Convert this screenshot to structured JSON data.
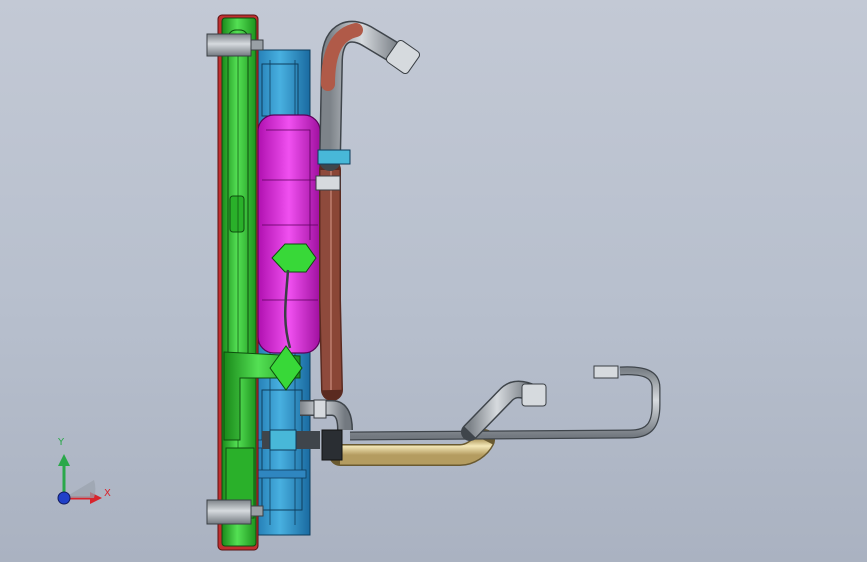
{
  "viewport": {
    "background": "#b9c0cd"
  },
  "triad": {
    "x_label": "X",
    "y_label": "Y",
    "x_color": "#d8242c",
    "y_color": "#2aa84a",
    "z_color": "#2040c8"
  },
  "components": {
    "radiator_color": "#2fc22f",
    "shroud_color": "#2a90c8",
    "expansion_tank_color": "#e020e0",
    "upper_hose_color": "#c07a6a",
    "steel_pipe_color": "#a0a6ac",
    "lower_pipe_color": "#e8d8a0",
    "clamp_color": "#48b8d8"
  }
}
